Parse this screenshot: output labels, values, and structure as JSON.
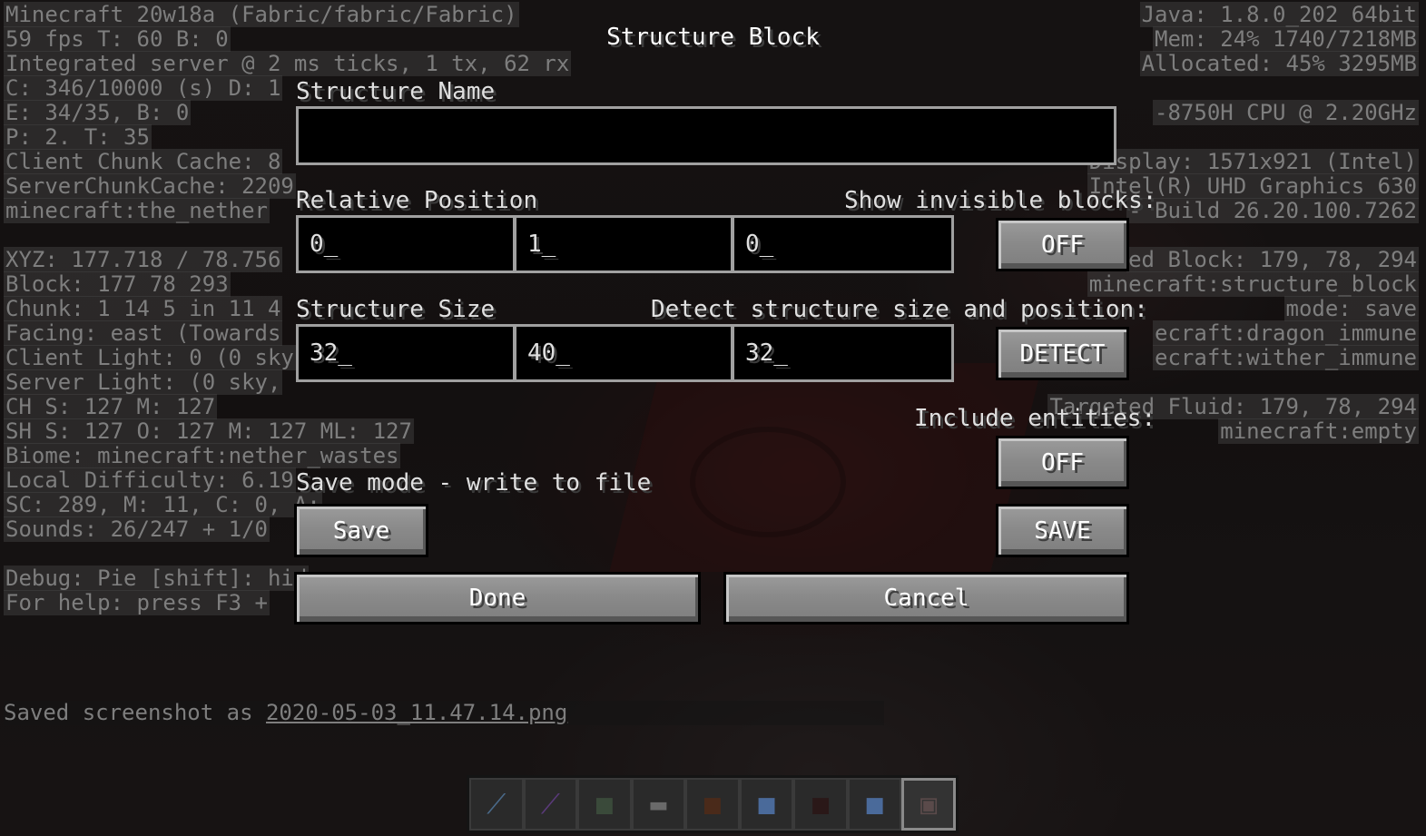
{
  "debug": {
    "left_lines": [
      "Minecraft 20w18a (Fabric/fabric/Fabric)",
      "59 fps T: 60 B: 0",
      "Integrated server @ 2 ms ticks, 1 tx, 62 rx",
      "C: 346/10000 (s) D: 1",
      "E: 34/35, B: 0",
      "P: 2. T: 35",
      "Client Chunk Cache: 8",
      "ServerChunkCache: 2209",
      "minecraft:the_nether",
      "",
      "XYZ: 177.718 / 78.756",
      "Block: 177 78 293",
      "Chunk: 1 14 5 in 11 4",
      "Facing: east (Towards",
      "Client Light: 0 (0 sky,",
      "Server Light: (0 sky,",
      "CH S: 127 M: 127",
      "SH S: 127 O: 127 M: 127 ML: 127",
      "Biome: minecraft:nether_wastes",
      "Local Difficulty: 6.19",
      "SC: 289, M: 11, C: 0, A:",
      "Sounds: 26/247 + 1/0",
      "",
      "Debug: Pie [shift]: hid",
      "For help: press F3 +"
    ],
    "right_lines": [
      "Java: 1.8.0_202 64bit",
      "Mem: 24% 1740/7218MB",
      "Allocated: 45% 3295MB",
      "",
      "-8750H CPU @ 2.20GHz",
      "",
      "Display: 1571x921 (Intel)",
      "Intel(R) UHD Graphics 630",
      "- Build 26.20.100.7262",
      "",
      "ed Block: 179, 78, 294",
      "minecraft:structure_block",
      "mode: save",
      "ecraft:dragon_immune",
      "ecraft:wither_immune",
      "",
      "Targeted Fluid: 179, 78, 294",
      "minecraft:empty"
    ]
  },
  "chat": {
    "prefix": "Saved screenshot as ",
    "filename": "2020-05-03_11.47.14.png"
  },
  "gui": {
    "title": "Structure Block",
    "structure_name_label": "Structure Name",
    "structure_name_value": "",
    "relative_position_label": "Relative Position",
    "position": {
      "x": "0_",
      "y": "1_",
      "z": "0_"
    },
    "show_invisible_label": "Show invisible blocks:",
    "show_invisible_button": "OFF",
    "structure_size_label": "Structure Size",
    "size": {
      "x": "32_",
      "y": "40_",
      "z": "32_"
    },
    "detect_label": "Detect structure size and position:",
    "detect_button": "DETECT",
    "include_entities_label": "Include entities:",
    "include_entities_button": "OFF",
    "mode_description": "Save mode - write to file",
    "mode_button": "Save",
    "save_button": "SAVE",
    "done_button": "Done",
    "cancel_button": "Cancel"
  },
  "hotbar": {
    "slots": [
      "sword-icon",
      "sword-icon",
      "block-icon",
      "slab-icon",
      "block-icon",
      "block-icon",
      "block-icon",
      "block-icon",
      "structure-block-icon"
    ],
    "selected_index": 8
  }
}
